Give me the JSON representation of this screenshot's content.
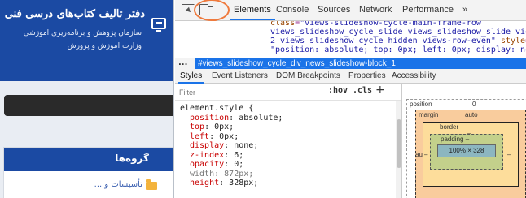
{
  "site": {
    "banner_title": "دفتر تالیف کتاب‌های درسی فنی و حرفه‌ای",
    "banner_sub1": "سازمان پژوهش و برنامه‌ریزی آموزشی",
    "banner_sub2": "وزارت آموزش و پرورش",
    "panel_title": "گروه‌ها",
    "panel_link": "تأسیسات و ..."
  },
  "devtools": {
    "tabs": [
      "Elements",
      "Console",
      "Sources",
      "Network",
      "Performance",
      "»"
    ],
    "active_tab": "Elements",
    "dom_lines": [
      {
        "parts": [
          [
            "attr",
            "class"
          ],
          [
            "txt",
            "="
          ],
          [
            "val",
            "\"views-slideshow-cycle-main-frame-row"
          ]
        ]
      },
      {
        "parts": [
          [
            "val",
            "views_slideshow_cycle_slide views_slideshow_slide views-row-"
          ]
        ]
      },
      {
        "parts": [
          [
            "val",
            "2 views_slideshow_cycle_hidden views-row-even\""
          ],
          [
            "attr",
            " style"
          ],
          [
            "txt",
            "="
          ]
        ]
      },
      {
        "parts": [
          [
            "val",
            "\"position: absolute; top: 0px; left: 0px; display: none; z-"
          ]
        ]
      }
    ],
    "breadcrumb": {
      "more": "...",
      "selected": "#views_slideshow_cycle_div_news_slideshow-block_1"
    },
    "sub_tabs": [
      "Styles",
      "Event Listeners",
      "DOM Breakpoints",
      "Properties",
      "Accessibility"
    ],
    "active_sub_tab": "Styles",
    "filter_placeholder": "Filter",
    "hov_label": ":hov",
    "cls_label": ".cls",
    "add_label": "+",
    "selector": "element.style {",
    "declarations": [
      {
        "prop": "position",
        "value": "absolute",
        "struck": false
      },
      {
        "prop": "top",
        "value": "0px",
        "struck": false
      },
      {
        "prop": "left",
        "value": "0px",
        "struck": false
      },
      {
        "prop": "display",
        "value": "none",
        "struck": false
      },
      {
        "prop": "z-index",
        "value": "6",
        "struck": false
      },
      {
        "prop": "opacity",
        "value": "0",
        "struck": false
      },
      {
        "prop": "width",
        "value": "872px",
        "struck": true
      },
      {
        "prop": "height",
        "value": "328px",
        "struck": false
      }
    ],
    "box_model": {
      "position_label": "position",
      "position_value": "0",
      "margin_label": "margin",
      "margin_value": "auto",
      "border_label": "border",
      "border_value": "–",
      "padding_label": "padding –",
      "content": "100% × 328",
      "side_left": "auto",
      "side_dash": "–",
      "side_right": "–"
    }
  },
  "colors": {
    "site_blue": "#1b4aa3",
    "selection_blue": "#1a73e8",
    "highlight_orange": "#ef7a3d"
  },
  "icons": [
    "inspect-element-icon",
    "device-toolbar-icon",
    "monitor-icon",
    "folder-icon"
  ]
}
